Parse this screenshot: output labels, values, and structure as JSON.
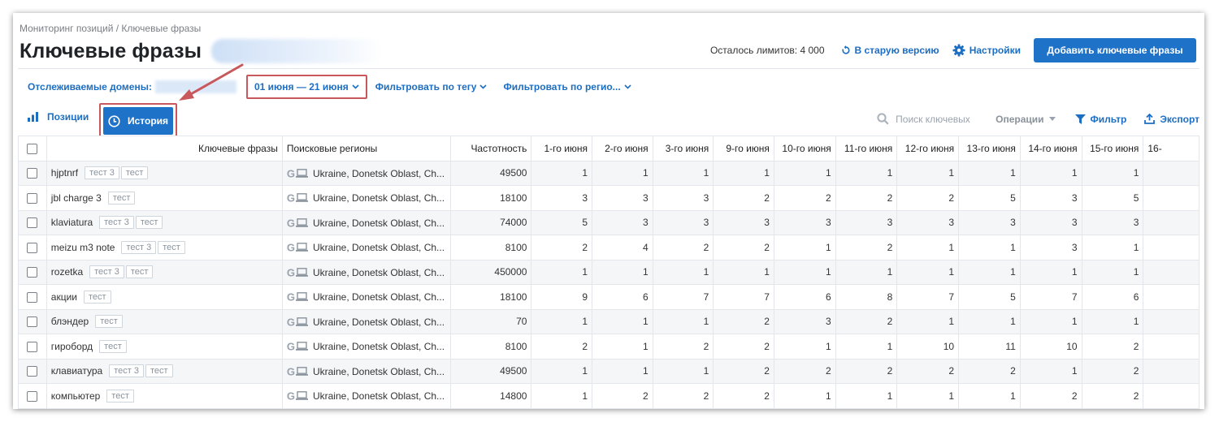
{
  "breadcrumb": "Мониторинг позиций / Ключевые фразы",
  "title": "Ключевые фразы",
  "header": {
    "limits": "Осталось лимитов: 4 000",
    "old_version": "В старую версию",
    "settings": "Настройки",
    "add_button": "Добавить ключевые фразы"
  },
  "filters": {
    "domains_label": "Отслеживаемые домены:",
    "date_range": "01 июня — 21 июня",
    "by_tag": "Фильтровать по тегу",
    "by_region": "Фильтровать по регио..."
  },
  "toolbar": {
    "positions_tab": "Позиции",
    "history_tab": "История",
    "search_placeholder": "Поиск ключевых",
    "operations": "Операции",
    "filter": "Фильтр",
    "export": "Экспорт"
  },
  "table": {
    "headers": {
      "keyword": "Ключевые фразы",
      "region": "Поисковые регионы",
      "frequency": "Частотность",
      "days": [
        "1-го июня",
        "2-го июня",
        "3-го июня",
        "9-го июня",
        "10-го июня",
        "11-го июня",
        "12-го июня",
        "13-го июня",
        "14-го июня",
        "15-го июня",
        "16-"
      ]
    },
    "rows": [
      {
        "keyword": "hjptnrf",
        "tags": [
          "тест 3",
          "тест"
        ],
        "region": "Ukraine, Donetsk Oblast, Ch...",
        "frequency": "49500",
        "days": [
          "1",
          "1",
          "1",
          "1",
          "1",
          "1",
          "1",
          "1",
          "1",
          "1"
        ]
      },
      {
        "keyword": "jbl charge 3",
        "tags": [
          "тест"
        ],
        "region": "Ukraine, Donetsk Oblast, Ch...",
        "frequency": "18100",
        "days": [
          "3",
          "3",
          "3",
          "2",
          "2",
          "2",
          "2",
          "5",
          "3",
          "5"
        ]
      },
      {
        "keyword": "klaviatura",
        "tags": [
          "тест 3",
          "тест"
        ],
        "region": "Ukraine, Donetsk Oblast, Ch...",
        "frequency": "74000",
        "days": [
          "5",
          "3",
          "3",
          "3",
          "3",
          "3",
          "3",
          "3",
          "3",
          "3"
        ]
      },
      {
        "keyword": "meizu m3 note",
        "tags": [
          "тест 3",
          "тест"
        ],
        "region": "Ukraine, Donetsk Oblast, Ch...",
        "frequency": "8100",
        "days": [
          "2",
          "4",
          "2",
          "2",
          "1",
          "2",
          "1",
          "1",
          "3",
          "1"
        ]
      },
      {
        "keyword": "rozetka",
        "tags": [
          "тест 3",
          "тест"
        ],
        "region": "Ukraine, Donetsk Oblast, Ch...",
        "frequency": "450000",
        "days": [
          "1",
          "1",
          "1",
          "1",
          "1",
          "1",
          "1",
          "1",
          "1",
          "1"
        ]
      },
      {
        "keyword": "акции",
        "tags": [
          "тест"
        ],
        "region": "Ukraine, Donetsk Oblast, Ch...",
        "frequency": "18100",
        "days": [
          "9",
          "6",
          "7",
          "7",
          "6",
          "8",
          "7",
          "5",
          "7",
          "6"
        ]
      },
      {
        "keyword": "блэндер",
        "tags": [
          "тест"
        ],
        "region": "Ukraine, Donetsk Oblast, Ch...",
        "frequency": "70",
        "days": [
          "1",
          "1",
          "1",
          "2",
          "3",
          "2",
          "1",
          "1",
          "1",
          "1"
        ]
      },
      {
        "keyword": "гироборд",
        "tags": [
          "тест"
        ],
        "region": "Ukraine, Donetsk Oblast, Ch...",
        "frequency": "8100",
        "days": [
          "2",
          "1",
          "2",
          "2",
          "1",
          "1",
          "10",
          "11",
          "10",
          "2"
        ]
      },
      {
        "keyword": "клавиатура",
        "tags": [
          "тест 3",
          "тест"
        ],
        "region": "Ukraine, Donetsk Oblast, Ch...",
        "frequency": "49500",
        "days": [
          "1",
          "1",
          "1",
          "2",
          "2",
          "2",
          "2",
          "2",
          "1",
          "2"
        ]
      },
      {
        "keyword": "компьютер",
        "tags": [
          "тест"
        ],
        "region": "Ukraine, Donetsk Oblast, Ch...",
        "frequency": "14800",
        "days": [
          "1",
          "2",
          "2",
          "2",
          "1",
          "1",
          "1",
          "1",
          "2",
          "2"
        ]
      }
    ]
  },
  "colors": {
    "accent": "#1e73c9",
    "link": "#1c6ec2",
    "highlight": "#c8585c",
    "row_stripe": "#f4f6f8"
  },
  "icons": [
    "refresh-icon",
    "gear-icon",
    "chevron-down-icon",
    "bar-chart-icon",
    "clock-icon",
    "search-icon",
    "funnel-icon",
    "export-icon",
    "google-icon",
    "desktop-icon"
  ]
}
